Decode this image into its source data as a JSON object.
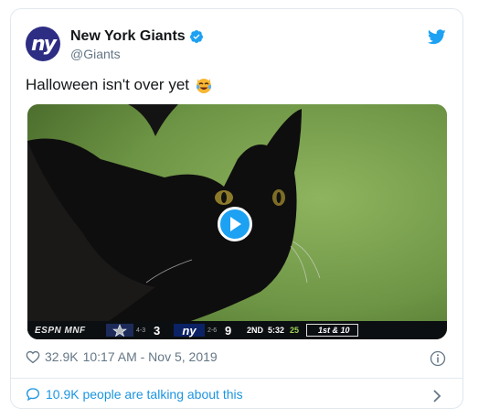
{
  "account": {
    "name": "New York Giants",
    "handle": "@Giants",
    "avatar_text": "ny",
    "avatar_color": "#2e2d84"
  },
  "tweet": {
    "text": "Halloween isn't over yet",
    "emoji": "crying-laughing-cat-emoji"
  },
  "video": {
    "play_icon": "play-icon",
    "scorebar": {
      "network": "ESPN MNF",
      "team1_record": "4-3",
      "team1_score": "3",
      "team2_logo": "ny",
      "team2_record": "2-6",
      "team2_score": "9",
      "quarter": "2ND",
      "clock": "5:32",
      "play_clock": "25",
      "down_distance": "1st & 10"
    }
  },
  "meta": {
    "likes": "32.9K",
    "timestamp": "10:17 AM - Nov 5, 2019"
  },
  "footer": {
    "talking": "10.9K people are talking about this"
  },
  "colors": {
    "twitter_blue": "#1da1f2",
    "link_blue": "#1b95e0",
    "muted_text": "#657786"
  }
}
